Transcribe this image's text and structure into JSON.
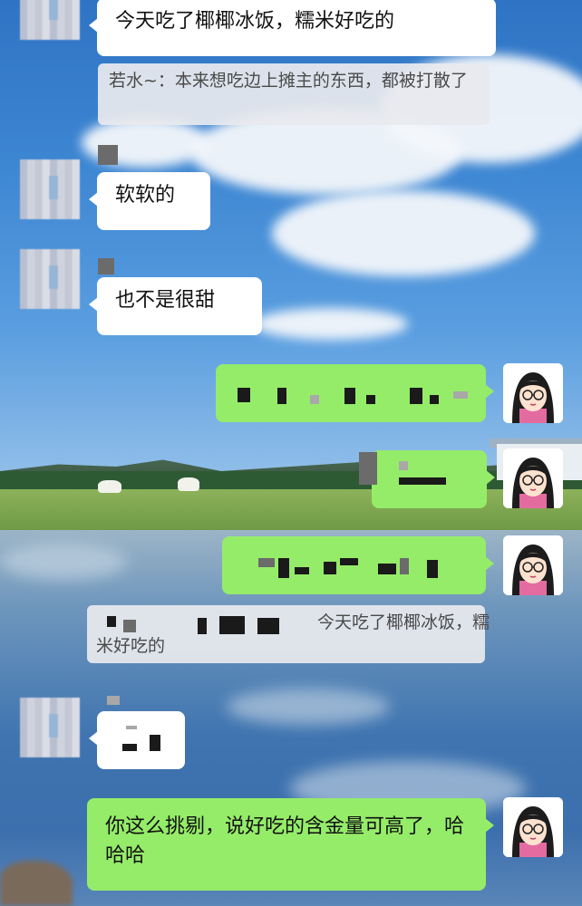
{
  "conversation": {
    "messages": [
      {
        "side": "left",
        "text": "今天吃了椰椰冰饭，糯米好吃的"
      },
      {
        "side": "left",
        "quote": "若水~：本来想吃边上摊主的东西，都被打散了"
      },
      {
        "side": "left",
        "text": "软软的"
      },
      {
        "side": "left",
        "text": "也不是很甜"
      },
      {
        "side": "right",
        "text": ""
      },
      {
        "side": "right",
        "text": ""
      },
      {
        "side": "right",
        "text": ""
      },
      {
        "side": "right",
        "quote": "今天吃了椰椰冰饭，糯米好吃的"
      },
      {
        "side": "left",
        "text": ""
      },
      {
        "side": "right",
        "text": "你这么挑剔，说好吃的含金量可高了，哈哈哈"
      }
    ]
  },
  "colors": {
    "incoming_bubble": "#ffffff",
    "outgoing_bubble": "#95ec69",
    "quote_background": "#e8eaee"
  },
  "icons": {
    "contact_avatar": "pixelated-avatar",
    "self_avatar": "girl-with-glasses-cartoon"
  }
}
